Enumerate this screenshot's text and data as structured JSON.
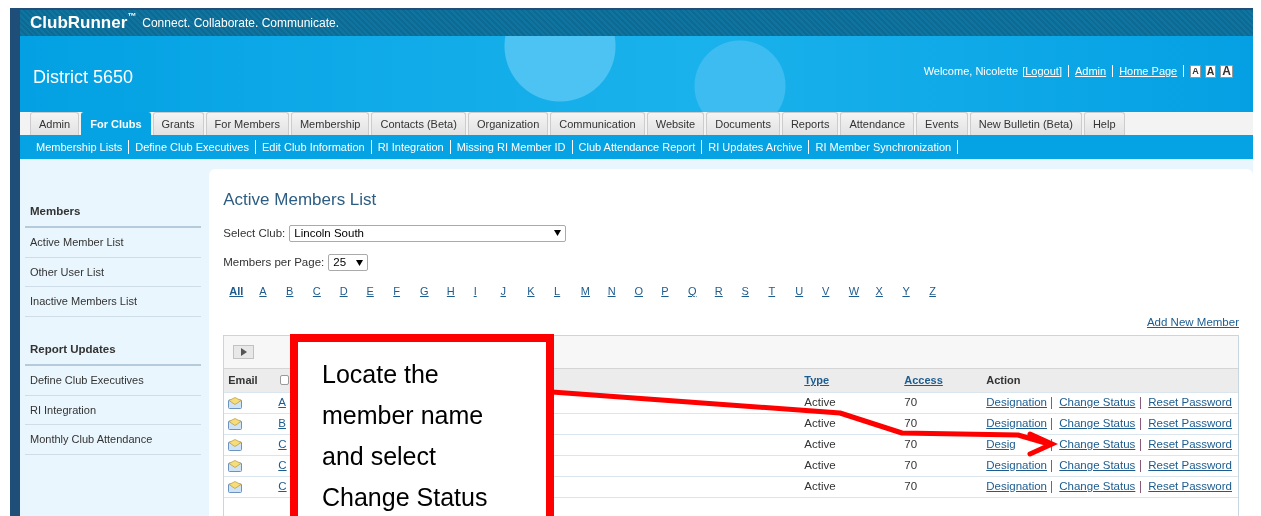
{
  "header": {
    "brand": "ClubRunner",
    "trademark": "™",
    "tagline": "Connect. Collaborate. Communicate."
  },
  "banner": {
    "title": "District 5650",
    "welcome": "Welcome, Nicolette",
    "links": [
      "[Logout]",
      "Admin",
      "Home Page"
    ],
    "font_buttons": [
      "A",
      "A",
      "A"
    ]
  },
  "tabs": [
    {
      "label": "Admin",
      "selected": false
    },
    {
      "label": "For Clubs",
      "selected": true
    },
    {
      "label": "Grants",
      "selected": false
    },
    {
      "label": "For Members",
      "selected": false
    },
    {
      "label": "Membership",
      "selected": false
    },
    {
      "label": "Contacts (Beta)",
      "selected": false
    },
    {
      "label": "Organization",
      "selected": false
    },
    {
      "label": "Communication",
      "selected": false
    },
    {
      "label": "Website",
      "selected": false
    },
    {
      "label": "Documents",
      "selected": false
    },
    {
      "label": "Reports",
      "selected": false
    },
    {
      "label": "Attendance",
      "selected": false
    },
    {
      "label": "Events",
      "selected": false
    },
    {
      "label": "New Bulletin (Beta)",
      "selected": false
    },
    {
      "label": "Help",
      "selected": false
    }
  ],
  "subnav": [
    "Membership Lists",
    "Define Club Executives",
    "Edit Club Information",
    "RI Integration",
    "Missing RI Member ID",
    "Club Attendance Report",
    "RI Updates Archive",
    "RI Member Synchronization"
  ],
  "sidebar": {
    "sections": [
      {
        "heading": "Members",
        "items": [
          "Active Member List",
          "Other User List",
          "Inactive Members List"
        ]
      },
      {
        "heading": "Report Updates",
        "items": [
          "Define Club Executives",
          "RI Integration",
          "Monthly Club Attendance"
        ]
      }
    ]
  },
  "main": {
    "title": "Active Members List",
    "club_label": "Select Club:",
    "club_value": "Lincoln South",
    "per_page_label": "Members per Page:",
    "per_page_value": "25",
    "select_all_checked": false,
    "letters": [
      {
        "label": "All",
        "selected": true
      },
      {
        "label": "A",
        "selected": false
      },
      {
        "label": "B",
        "selected": false
      },
      {
        "label": "C",
        "selected": false
      },
      {
        "label": "D",
        "selected": false
      },
      {
        "label": "E",
        "selected": false
      },
      {
        "label": "F",
        "selected": false
      },
      {
        "label": "G",
        "selected": false
      },
      {
        "label": "H",
        "selected": false
      },
      {
        "label": "I",
        "selected": false
      },
      {
        "label": "J",
        "selected": false
      },
      {
        "label": "K",
        "selected": false
      },
      {
        "label": "L",
        "selected": false
      },
      {
        "label": "M",
        "selected": false
      },
      {
        "label": "N",
        "selected": false
      },
      {
        "label": "O",
        "selected": false
      },
      {
        "label": "P",
        "selected": false
      },
      {
        "label": "Q",
        "selected": false
      },
      {
        "label": "R",
        "selected": false
      },
      {
        "label": "S",
        "selected": false
      },
      {
        "label": "T",
        "selected": false
      },
      {
        "label": "U",
        "selected": false
      },
      {
        "label": "V",
        "selected": false
      },
      {
        "label": "W",
        "selected": false
      },
      {
        "label": "X",
        "selected": false
      },
      {
        "label": "Y",
        "selected": false
      },
      {
        "label": "Z",
        "selected": false
      }
    ],
    "add_link": "Add New Member",
    "table": {
      "columns": [
        {
          "label": "Email",
          "sortable": false
        },
        {
          "label": "Type",
          "sortable": true
        },
        {
          "label": "Access",
          "sortable": true
        },
        {
          "label": "Action",
          "sortable": false
        }
      ],
      "rows": [
        {
          "name": "A",
          "type": "Active",
          "access": "70",
          "actions": [
            "Designation",
            "Change Status",
            "Reset Password"
          ]
        },
        {
          "name": "B",
          "type": "Active",
          "access": "70",
          "actions": [
            "Designation",
            "Change Status",
            "Reset Password"
          ]
        },
        {
          "name": "C",
          "type": "Active",
          "access": "70",
          "actions": [
            "Desig",
            "Change Status",
            "Reset Password"
          ]
        },
        {
          "name": "C",
          "type": "Active",
          "access": "70",
          "actions": [
            "Designation",
            "Change Status",
            "Reset Password"
          ]
        },
        {
          "name": "C",
          "type": "Active",
          "access": "70",
          "actions": [
            "Designation",
            "Change Status",
            "Reset Password"
          ]
        }
      ]
    }
  },
  "callout": {
    "text": "Locate the member name and select Change Status"
  }
}
